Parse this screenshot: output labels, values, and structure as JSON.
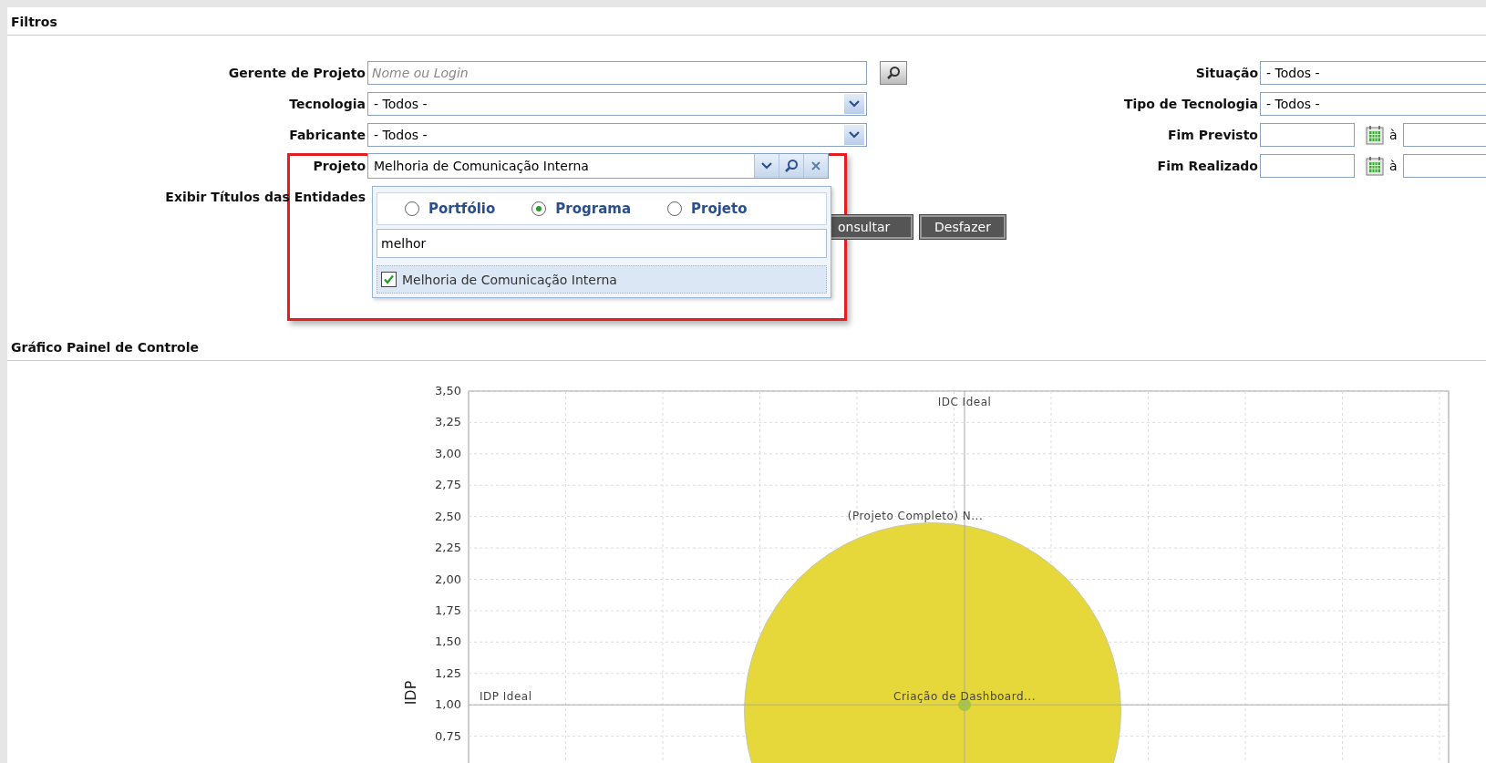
{
  "filters": {
    "title": "Filtros",
    "left_fields": [
      {
        "kind": "lookup",
        "label": "Gerente de Projeto",
        "placeholder": "Nome ou Login"
      },
      {
        "kind": "select",
        "label": "Tecnologia",
        "value": "- Todos -"
      },
      {
        "kind": "select",
        "label": "Fabricante",
        "value": "- Todos -"
      },
      {
        "kind": "combo",
        "label": "Projeto",
        "value": "Melhoria de Comunicação Interna"
      },
      {
        "kind": "label_only",
        "label": "Exibir Títulos das Entidades"
      }
    ],
    "right_fields": [
      {
        "kind": "select",
        "label": "Situação",
        "value": "- Todos -"
      },
      {
        "kind": "select",
        "label": "Tipo de Tecnologia",
        "value": "- Todos -"
      },
      {
        "kind": "date_range",
        "label": "Fim Previsto",
        "separator": "à"
      },
      {
        "kind": "date_range",
        "label": "Fim Realizado",
        "separator": "à"
      }
    ],
    "buttons": [
      "onsultar",
      "Desfazer"
    ],
    "project_popup": {
      "entity_types": [
        {
          "label": "Portfólio",
          "selected": false
        },
        {
          "label": "Programa",
          "selected": true
        },
        {
          "label": "Projeto",
          "selected": false
        }
      ],
      "search_value": "melhor",
      "results": [
        {
          "label": "Melhoria de Comunicação Interna",
          "checked": true
        }
      ]
    }
  },
  "chart_panel": {
    "title": "Gráfico Painel de Controle",
    "chart_data": {
      "type": "scatter",
      "ylabel": "IDP",
      "ylim": [
        0.5,
        3.5
      ],
      "yticks": [
        {
          "value": 0.75,
          "label": "0,75"
        },
        {
          "value": 1,
          "label": "1,00"
        },
        {
          "value": 1.25,
          "label": "1,25"
        },
        {
          "value": 1.5,
          "label": "1,50"
        },
        {
          "value": 1.75,
          "label": "1,75"
        },
        {
          "value": 2,
          "label": "2,00"
        },
        {
          "value": 2.25,
          "label": "2,25"
        },
        {
          "value": 2.5,
          "label": "2,50"
        },
        {
          "value": 2.75,
          "label": "2,75"
        },
        {
          "value": 3,
          "label": "3,00"
        },
        {
          "value": 3.25,
          "label": "3,25"
        },
        {
          "value": 3.5,
          "label": "3,50"
        }
      ],
      "series": [
        {
          "name": "(Projeto Completo) N...",
          "color": "#e6d83a",
          "values": [
            0.95
          ]
        },
        {
          "name": "Criação de Dashboard...",
          "color": "#a8c83a",
          "values": [
            1.0
          ]
        }
      ],
      "grid": true,
      "ref_lines": [
        {
          "axis": "x",
          "label": "IDC Ideal"
        },
        {
          "axis": "y",
          "value": 1.0,
          "label": "IDP Ideal"
        }
      ]
    }
  }
}
